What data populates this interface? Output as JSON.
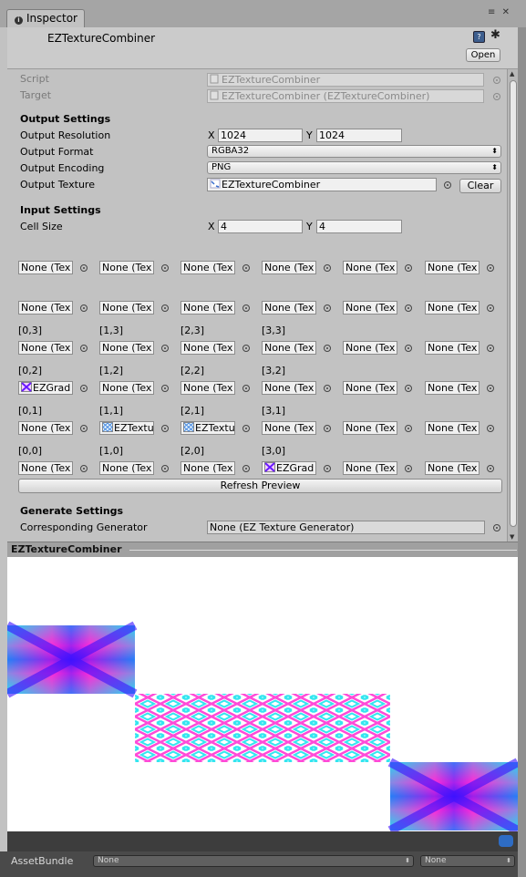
{
  "window": {
    "tab_label": "Inspector",
    "header_title": "EZTextureCombiner",
    "open_button": "Open"
  },
  "fields": {
    "script_label": "Script",
    "script_value": "EZTextureCombiner",
    "target_label": "Target",
    "target_value": "EZTextureCombiner (EZTextureCombiner)"
  },
  "output": {
    "section": "Output Settings",
    "resolution_label": "Output Resolution",
    "x_label": "X",
    "y_label": "Y",
    "res_x": "1024",
    "res_y": "1024",
    "format_label": "Output Format",
    "format_value": "RGBA32",
    "encoding_label": "Output Encoding",
    "encoding_value": "PNG",
    "texture_label": "Output Texture",
    "texture_value": "EZTextureCombiner",
    "clear_button": "Clear"
  },
  "input": {
    "section": "Input Settings",
    "cellsize_label": "Cell Size",
    "x_label": "X",
    "y_label": "Y",
    "cell_x": "4",
    "cell_y": "4"
  },
  "grid": {
    "rows": [
      {
        "labels": [
          "",
          "",
          "",
          "",
          "",
          ""
        ],
        "cells": [
          "None (Tex",
          "None (Tex",
          "None (Tex",
          "None (Tex",
          "None (Tex",
          "None (Tex"
        ]
      },
      {
        "labels": [
          "",
          "",
          "",
          "",
          "",
          ""
        ],
        "cells": [
          "None (Tex",
          "None (Tex",
          "None (Tex",
          "None (Tex",
          "None (Tex",
          "None (Tex"
        ]
      },
      {
        "labels": [
          "[0,3]",
          "[1,3]",
          "[2,3]",
          "[3,3]",
          "",
          ""
        ],
        "cells": [
          "None (Tex",
          "None (Tex",
          "None (Tex",
          "None (Tex",
          "None (Tex",
          "None (Tex"
        ]
      },
      {
        "labels": [
          "[0,2]",
          "[1,2]",
          "[2,2]",
          "[3,2]",
          "",
          ""
        ],
        "cells": [
          "EZGrad",
          "None (Tex",
          "None (Tex",
          "None (Tex",
          "None (Tex",
          "None (Tex"
        ]
      },
      {
        "labels": [
          "[0,1]",
          "[1,1]",
          "[2,1]",
          "[3,1]",
          "",
          ""
        ],
        "cells": [
          "None (Tex",
          "EZTextu",
          "EZTextu",
          "None (Tex",
          "None (Tex",
          "None (Tex"
        ]
      },
      {
        "labels": [
          "[0,0]",
          "[1,0]",
          "[2,0]",
          "[3,0]",
          "",
          ""
        ],
        "cells": [
          "None (Tex",
          "None (Tex",
          "None (Tex",
          "EZGrad",
          "None (Tex",
          "None (Tex"
        ]
      }
    ],
    "icons": {
      "3-0": "x-texture-icon",
      "4-1": "diamond-texture-icon",
      "4-2": "diamond-texture-icon",
      "5-3": "x-texture-icon"
    }
  },
  "refresh_button": "Refresh Preview",
  "generate": {
    "section": "Generate Settings",
    "generator_label": "Corresponding Generator",
    "generator_value": "None (EZ Texture Generator)"
  },
  "preview": {
    "title": "EZTextureCombiner",
    "columns": 4,
    "rows": 4,
    "filled_cells": [
      {
        "col": 0,
        "row": 2,
        "pattern": "x-gradient"
      },
      {
        "col": 1,
        "row": 1,
        "pattern": "diamond-stripes"
      },
      {
        "col": 2,
        "row": 1,
        "pattern": "diamond-stripes"
      },
      {
        "col": 3,
        "row": 0,
        "pattern": "x-gradient"
      }
    ]
  },
  "assetbundle": {
    "label": "AssetBundle",
    "value1": "None",
    "value2": "None"
  },
  "colors": {
    "panel": "#c2c2c2",
    "gradient_magenta": "#ff2bd6",
    "gradient_cyan": "#33e6f0",
    "gradient_blue": "#3a1bff"
  }
}
